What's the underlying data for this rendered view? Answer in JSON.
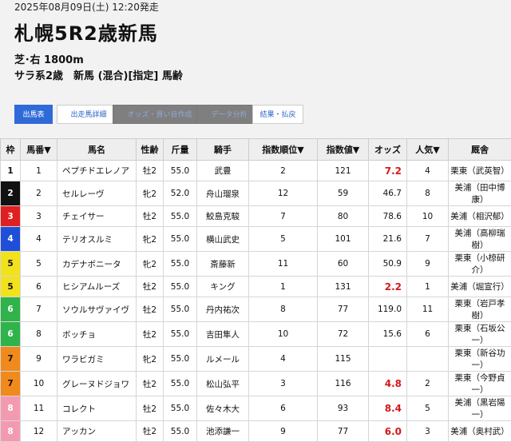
{
  "race": {
    "datetime": "2025年08月09日(土) 12:20発走",
    "title": "札幌5R2歳新馬",
    "course": "芝･右 1800m",
    "conditions": "サラ系2歳　新馬 (混合)[指定] 馬齢"
  },
  "tabs": [
    {
      "label": "出馬表",
      "state": "active"
    },
    {
      "label": "出走馬詳細",
      "state": "normal"
    },
    {
      "label": "オッズ・買い目作成",
      "state": "disabled"
    },
    {
      "label": "データ分析",
      "state": "disabled"
    },
    {
      "label": "結果・払戻",
      "state": "normal"
    }
  ],
  "table": {
    "headers": [
      "枠",
      "馬番▼",
      "馬名",
      "性齢",
      "斤量",
      "騎手",
      "指数順位▼",
      "指数値▼",
      "オッズ",
      "人気▼",
      "厩舎"
    ],
    "rows": [
      {
        "waku": "1",
        "umaban": "1",
        "name": "ペプチドエレノア",
        "sexage": "牡2",
        "weight": "55.0",
        "jockey": "武豊",
        "rank": "2",
        "index": "121",
        "odds": "7.2",
        "pop": "4",
        "stable": "栗東（武英智）"
      },
      {
        "waku": "2",
        "umaban": "2",
        "name": "セルレーヴ",
        "sexage": "牝2",
        "weight": "52.0",
        "jockey": "舟山瑠泉",
        "rank": "12",
        "index": "59",
        "odds": "46.7",
        "pop": "8",
        "stable": "美浦（田中博康）"
      },
      {
        "waku": "3",
        "umaban": "3",
        "name": "チェイサー",
        "sexage": "牡2",
        "weight": "55.0",
        "jockey": "鮫島克駿",
        "rank": "7",
        "index": "80",
        "odds": "78.6",
        "pop": "10",
        "stable": "美浦（相沢郁）"
      },
      {
        "waku": "4",
        "umaban": "4",
        "name": "テリオスルミ",
        "sexage": "牝2",
        "weight": "55.0",
        "jockey": "横山武史",
        "rank": "5",
        "index": "101",
        "odds": "21.6",
        "pop": "7",
        "stable": "美浦（高柳瑞樹）"
      },
      {
        "waku": "5",
        "umaban": "5",
        "name": "カデナボニータ",
        "sexage": "牝2",
        "weight": "55.0",
        "jockey": "斎藤新",
        "rank": "11",
        "index": "60",
        "odds": "50.9",
        "pop": "9",
        "stable": "栗東（小椋研介）"
      },
      {
        "waku": "5",
        "umaban": "6",
        "name": "ヒシアムルーズ",
        "sexage": "牡2",
        "weight": "55.0",
        "jockey": "キング",
        "rank": "1",
        "index": "131",
        "odds": "2.2",
        "pop": "1",
        "stable": "美浦（堀宣行）"
      },
      {
        "waku": "6",
        "umaban": "7",
        "name": "ソウルサヴァイヴ",
        "sexage": "牡2",
        "weight": "55.0",
        "jockey": "丹内祐次",
        "rank": "8",
        "index": "77",
        "odds": "119.0",
        "pop": "11",
        "stable": "栗東（岩戸孝樹）"
      },
      {
        "waku": "6",
        "umaban": "8",
        "name": "ボッチョ",
        "sexage": "牡2",
        "weight": "55.0",
        "jockey": "吉田隼人",
        "rank": "10",
        "index": "72",
        "odds": "15.6",
        "pop": "6",
        "stable": "栗東（石坂公一）"
      },
      {
        "waku": "7",
        "umaban": "9",
        "name": "ワラビガミ",
        "sexage": "牝2",
        "weight": "55.0",
        "jockey": "ルメール",
        "rank": "4",
        "index": "115",
        "odds": "",
        "pop": "",
        "stable": "栗東（新谷功一）"
      },
      {
        "waku": "7",
        "umaban": "10",
        "name": "グレーヌドジョワ",
        "sexage": "牡2",
        "weight": "55.0",
        "jockey": "松山弘平",
        "rank": "3",
        "index": "116",
        "odds": "4.8",
        "pop": "2",
        "stable": "栗東（今野貞一）"
      },
      {
        "waku": "8",
        "umaban": "11",
        "name": "コレクト",
        "sexage": "牡2",
        "weight": "55.0",
        "jockey": "佐々木大",
        "rank": "6",
        "index": "93",
        "odds": "8.4",
        "pop": "5",
        "stable": "美浦（黒岩陽一）"
      },
      {
        "waku": "8",
        "umaban": "12",
        "name": "アッカン",
        "sexage": "牡2",
        "weight": "55.0",
        "jockey": "池添謙一",
        "rank": "9",
        "index": "77",
        "odds": "6.0",
        "pop": "3",
        "stable": "美浦（奥村武）"
      }
    ]
  },
  "waku_colors": {
    "1": {
      "bg": "#ffffff",
      "fg": "#111111"
    },
    "2": {
      "bg": "#111111",
      "fg": "#ffffff"
    },
    "3": {
      "bg": "#e02020",
      "fg": "#ffffff"
    },
    "4": {
      "bg": "#1f4fd8",
      "fg": "#ffffff"
    },
    "5": {
      "bg": "#f2e21b",
      "fg": "#111111"
    },
    "6": {
      "bg": "#2fb34a",
      "fg": "#ffffff"
    },
    "7": {
      "bg": "#f08a1c",
      "fg": "#111111"
    },
    "8": {
      "bg": "#f39ab0",
      "fg": "#ffffff"
    }
  },
  "fav_odds_color": "#d21a1a"
}
